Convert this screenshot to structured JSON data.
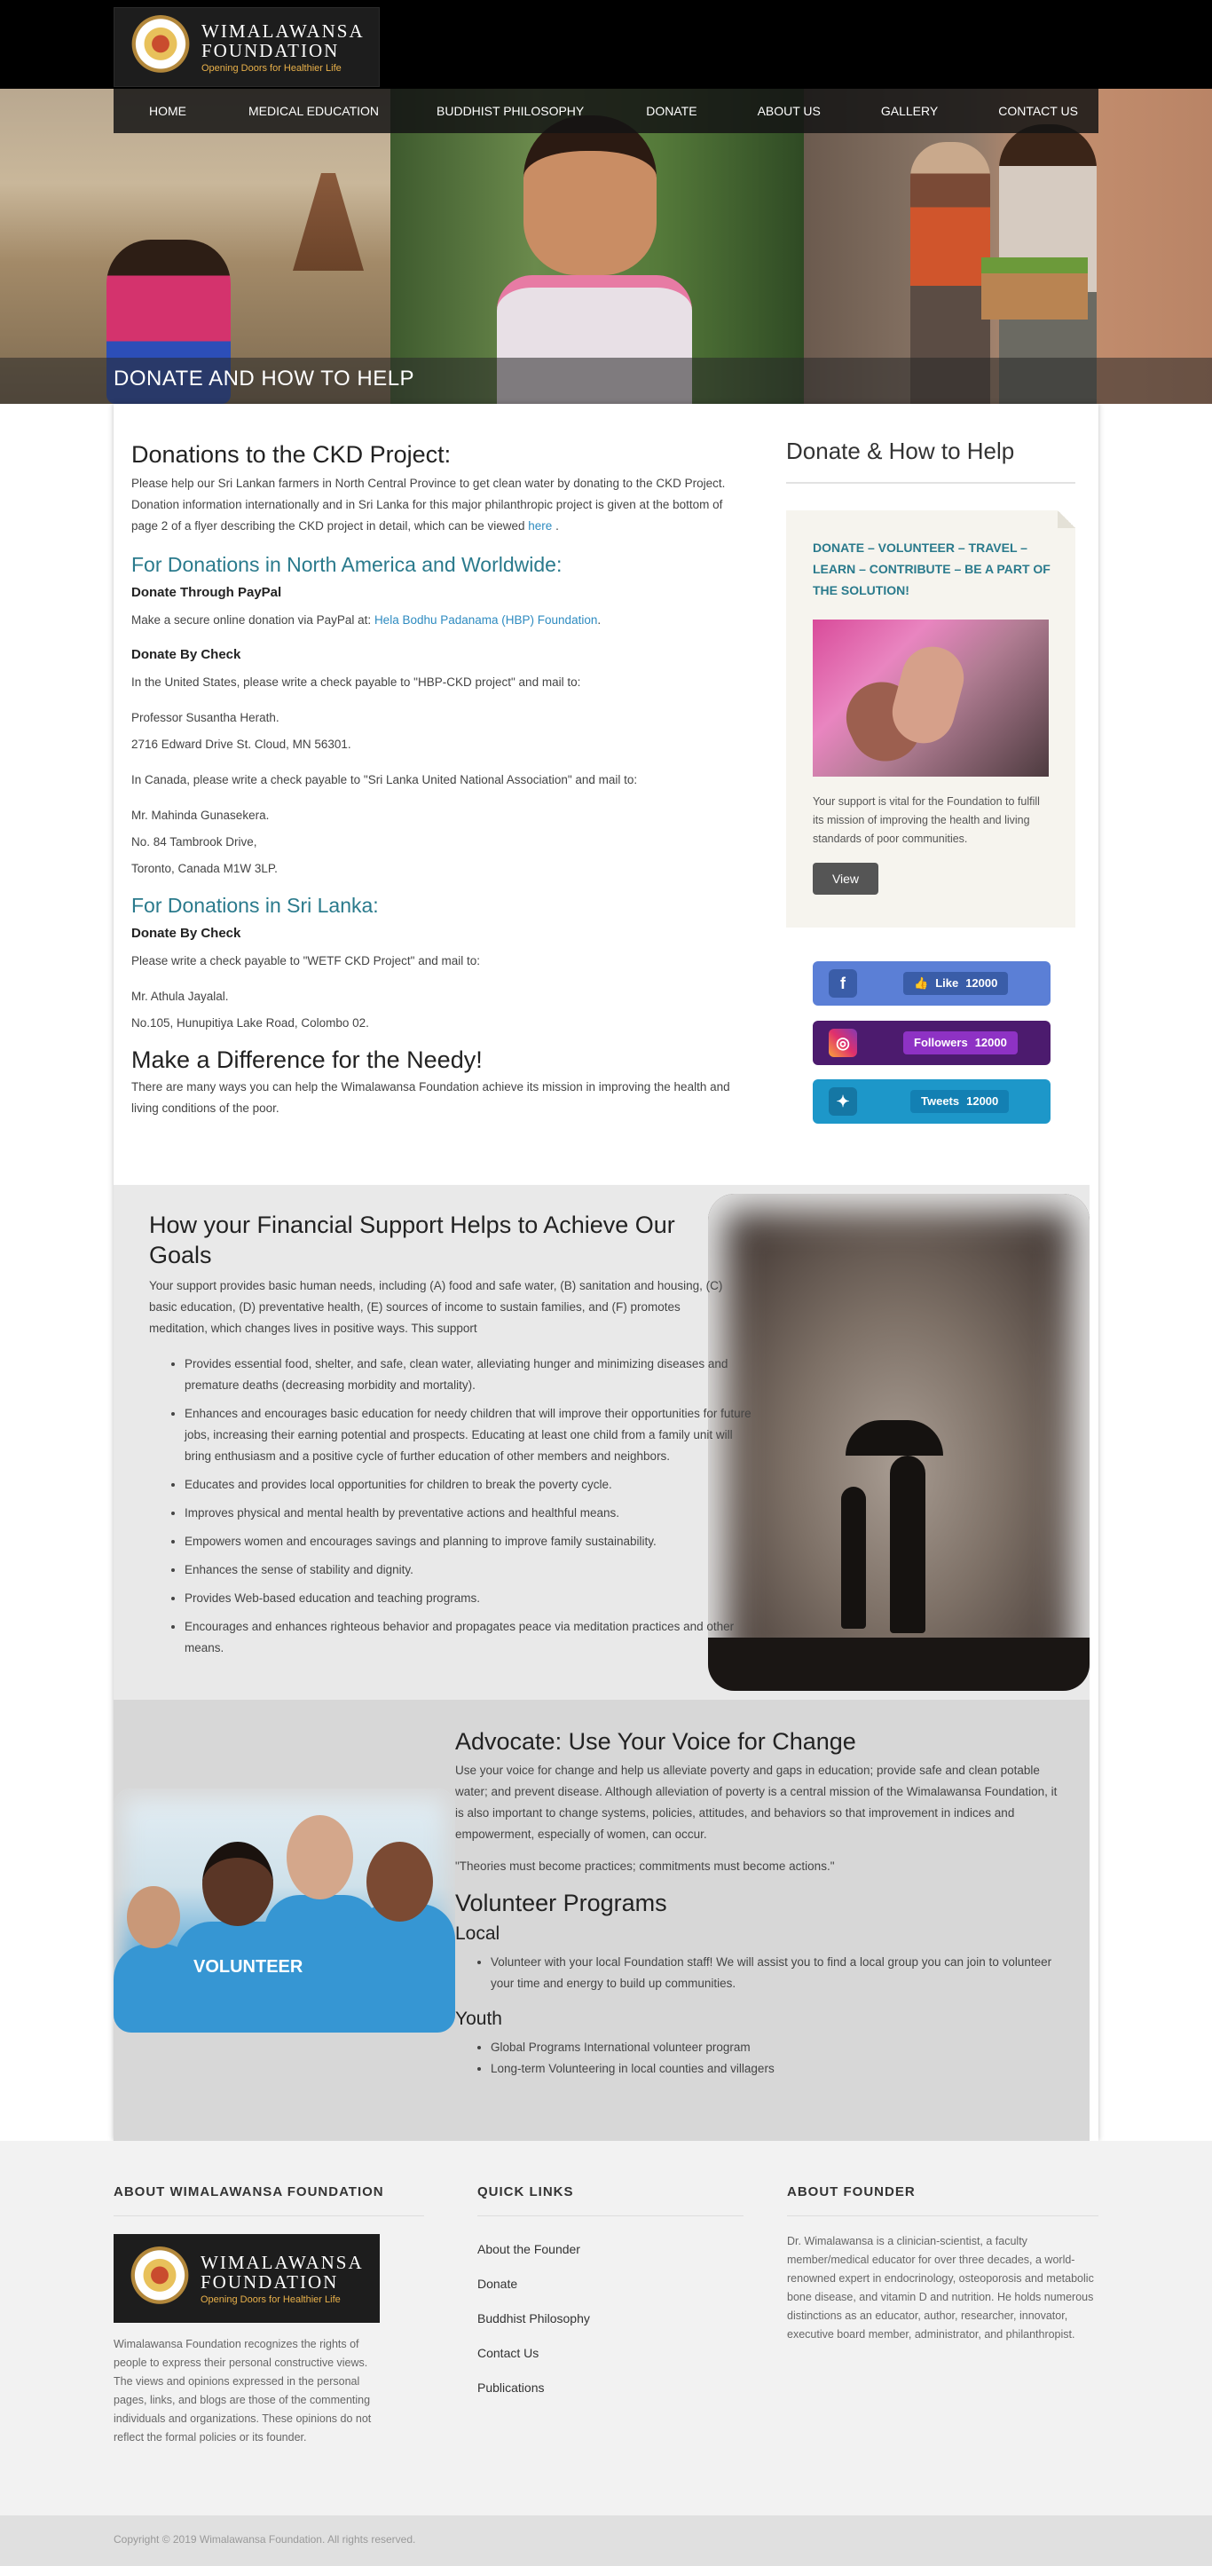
{
  "brand": {
    "name_line1": "WIMALAWANSA",
    "name_line2": "FOUNDATION",
    "tagline": "Opening Doors for Healthier Life"
  },
  "nav": {
    "items": [
      "HOME",
      "MEDICAL EDUCATION",
      "BUDDHIST PHILOSOPHY",
      "DONATE",
      "ABOUT US",
      "GALLERY",
      "CONTACT US"
    ]
  },
  "hero": {
    "title": "DONATE AND HOW TO HELP"
  },
  "main": {
    "ckd_title": "Donations to the CKD Project:",
    "ckd_text": "Please help our Sri Lankan farmers in North Central Province to get clean water by donating to the CKD Project. Donation information internationally and in Sri Lanka for this major philanthropic project is given at the bottom of page 2 of a flyer describing the CKD project in detail, which can be viewed",
    "ckd_link": "here",
    "ckd_end": ".",
    "na_title": "For Donations in North America and Worldwide:",
    "paypal_title": "Donate Through PayPal",
    "paypal_text": "Make a secure online donation via PayPal at:",
    "paypal_link": "Hela Bodhu Padanama (HBP) Foundation",
    "paypal_end": ".",
    "check_title": "Donate By Check",
    "us_text": "In the United States, please write a check payable to \"HBP-CKD project\" and mail to:",
    "us_addr1": "Professor Susantha Herath.",
    "us_addr2": "2716 Edward Drive St. Cloud, MN 56301.",
    "ca_text": "In Canada, please write a check payable to \"Sri Lanka United National Association\" and mail to:",
    "ca_addr1": "Mr. Mahinda Gunasekera.",
    "ca_addr2": "No. 84 Tambrook Drive,",
    "ca_addr3": "Toronto, Canada M1W 3LP.",
    "sl_title": "For Donations in Sri Lanka:",
    "sl_check_title": "Donate By Check",
    "sl_text": "Please write a check payable to \"WETF CKD Project\" and mail to:",
    "sl_addr1": "Mr. Athula Jayalal.",
    "sl_addr2": "No.105, Hunupitiya Lake Road, Colombo 02.",
    "diff_title": "Make a Difference for the Needy!",
    "diff_text": "There are many ways you can help the Wimalawansa Foundation achieve its mission in improving the health and living conditions of the poor."
  },
  "sidebar": {
    "title": "Donate & How to Help",
    "card_title": "DONATE – VOLUNTEER – TRAVEL – LEARN – CONTRIBUTE – BE A PART OF THE SOLUTION!",
    "card_text": "Your support is vital for the Foundation to fulfill its mission of improving the health and living standards of poor communities.",
    "view_label": "View",
    "facebook": {
      "label": "Like",
      "count": "12000"
    },
    "instagram": {
      "label": "Followers",
      "count": "12000"
    },
    "twitter": {
      "label": "Tweets",
      "count": "12000"
    }
  },
  "financial": {
    "title": "How your Financial Support Helps to Achieve Our Goals",
    "intro": "Your support provides basic human needs, including (A) food and safe water, (B) sanitation and housing, (C) basic education, (D) preventative health, (E) sources of income to sustain families, and (F) promotes meditation, which changes lives in positive ways. This support",
    "bullets": [
      "Provides essential food, shelter, and safe, clean water, alleviating hunger and minimizing diseases and premature deaths (decreasing morbidity and mortality).",
      "Enhances and encourages basic education for needy children that will improve their opportunities for future jobs, increasing their earning potential and prospects. Educating at least one child from a family unit will bring enthusiasm and a positive cycle of further education of other members and neighbors.",
      "Educates and provides local opportunities for children to break the poverty cycle.",
      "Improves physical and mental health by preventative actions and healthful means.",
      "Empowers women and encourages savings and planning to improve family sustainability.",
      "Enhances the sense of stability and dignity.",
      "Provides Web-based education and teaching programs.",
      "Encourages and enhances righteous behavior and propagates peace via meditation practices and other means."
    ]
  },
  "advocate": {
    "title": "Advocate: Use Your Voice for Change",
    "text": "Use your voice for change and help us alleviate poverty and gaps in education; provide safe and clean potable water; and prevent disease. Although alleviation of poverty is a central mission of the Wimalawansa Foundation, it is also important to change systems, policies, attitudes, and behaviors so that improvement in indices and empowerment, especially of women, can occur.",
    "quote": "\"Theories must become practices; commitments must become actions.\"",
    "vol_title": "Volunteer Programs",
    "local_title": "Local",
    "local_item": "Volunteer with your local Foundation staff! We will assist you to find a local group you can join to volunteer your time and energy to build up communities.",
    "youth_title": "Youth",
    "youth_items": [
      "Global Programs International volunteer program",
      "Long-term Volunteering in local counties and villagers"
    ],
    "img_shirt_text": "VOLUNTEER"
  },
  "footer": {
    "about_title": "ABOUT WIMALAWANSA FOUNDATION",
    "about_text": "Wimalawansa Foundation recognizes the rights of people to express their personal constructive views. The views and opinions expressed in the personal pages, links, and blogs are those of the commenting individuals and organizations. These opinions do not reflect the formal policies or its founder.",
    "links_title": "QUICK LINKS",
    "links": [
      "About the Founder",
      "Donate",
      "Buddhist Philosophy",
      "Contact Us",
      "Publications"
    ],
    "founder_title": "ABOUT FOUNDER",
    "founder_text": "Dr. Wimalawansa is a clinician-scientist, a faculty member/medical educator for over three decades, a world-renowned expert in endocrinology, osteoporosis and metabolic bone disease, and vitamin D and nutrition. He holds numerous distinctions as an educator, author, researcher, innovator, executive board member, administrator, and philanthropist.",
    "copyright": "Copyright © 2019 Wimalawansa Foundation. All rights reserved."
  }
}
